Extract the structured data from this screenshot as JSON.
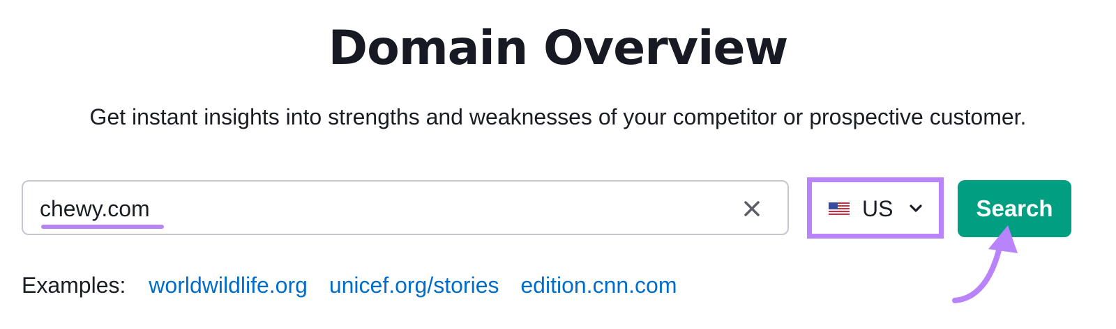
{
  "header": {
    "title": "Domain Overview",
    "subtitle": "Get instant insights into strengths and weaknesses of your competitor or prospective customer."
  },
  "search": {
    "value": "chewy.com",
    "clear_icon": "close-icon"
  },
  "country": {
    "label": "US",
    "flag_icon": "us-flag-icon",
    "dropdown_icon": "chevron-down-icon"
  },
  "actions": {
    "search_label": "Search"
  },
  "examples": {
    "label": "Examples:",
    "links": [
      "worldwildlife.org",
      "unicef.org/stories",
      "edition.cnn.com"
    ]
  },
  "annotations": {
    "highlight_color": "#b983fb",
    "arrow_icon": "curved-arrow-icon"
  },
  "colors": {
    "accent": "#009f81",
    "link": "#006dca"
  }
}
